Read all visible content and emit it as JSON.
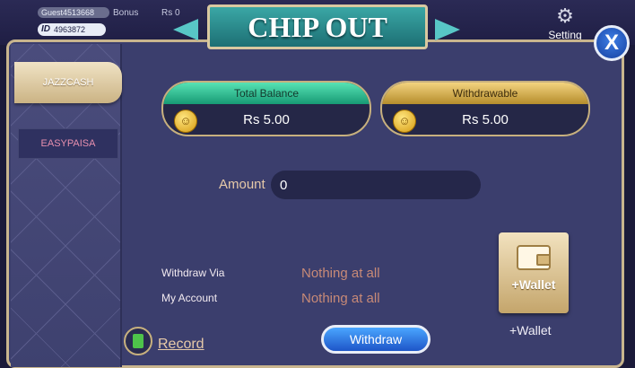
{
  "header": {
    "username": "Guest4513668",
    "id_prefix": "ID",
    "id_value": "4963872",
    "bonus_label": "Bonus",
    "balance_label": "Rs 0",
    "settings_label": "Setting"
  },
  "dialog": {
    "title": "CHIP OUT",
    "close_label": "X"
  },
  "sidebar": {
    "tabs": [
      {
        "label": "JAZZCASH",
        "selected": true
      },
      {
        "label": "EASYPAISA",
        "selected": false
      }
    ]
  },
  "balances": {
    "total": {
      "label": "Total Balance",
      "value": "Rs 5.00"
    },
    "withdrawable": {
      "label": "Withdrawable",
      "value": "Rs 5.00"
    }
  },
  "form": {
    "amount_label": "Amount",
    "amount_value": "0",
    "withdraw_via_label": "Withdraw Via",
    "withdraw_via_value": "Nothing at all",
    "my_account_label": "My Account",
    "my_account_value": "Nothing at all"
  },
  "wallet": {
    "button_label": "+Wallet",
    "caption": "+Wallet"
  },
  "record_label": "Record",
  "withdraw_label": "Withdraw",
  "colors": {
    "dialog_bg": "#3b3e6d",
    "accent_gold": "#c7b07e",
    "total_green": "#2ec18f",
    "withdraw_gold": "#d9b04e",
    "withdraw_button": "#2f7be8"
  }
}
